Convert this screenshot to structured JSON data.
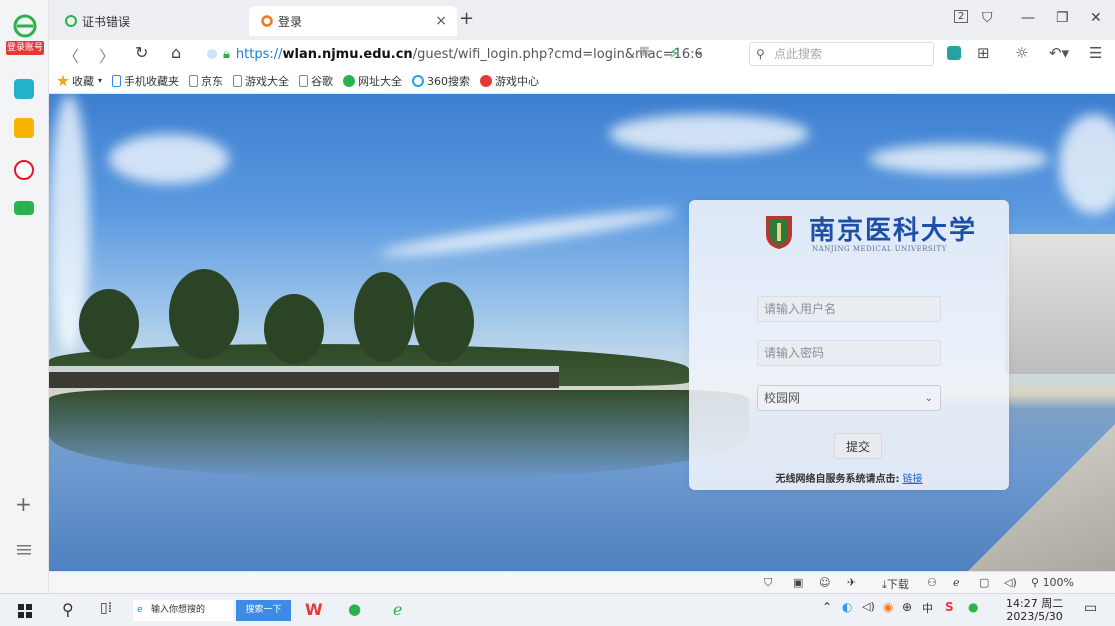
{
  "sidebar": {
    "login_label": "登录账号"
  },
  "tabs": [
    {
      "title": "证书错误"
    },
    {
      "title": "登录"
    }
  ],
  "address": {
    "scheme": "https://",
    "host": "wlan.njmu.edu.cn",
    "path": "/guest/wifi_login.php?cmd=login&mac=16:6",
    "search_placeholder": "点此搜索"
  },
  "bookmarks": [
    {
      "label": "收藏",
      "icon": "star-icon",
      "color": "#f5a623"
    },
    {
      "label": "手机收藏夹",
      "icon": "phone-icon",
      "color": "#2d8cf0"
    },
    {
      "label": "京东",
      "icon": "page-icon",
      "color": "#888888"
    },
    {
      "label": "游戏大全",
      "icon": "page-icon",
      "color": "#888888"
    },
    {
      "label": "谷歌",
      "icon": "page-icon",
      "color": "#888888"
    },
    {
      "label": "网址大全",
      "icon": "globe-icon",
      "color": "#2bb24c"
    },
    {
      "label": "360搜索",
      "icon": "search360-icon",
      "color": "#2aa0e8"
    },
    {
      "label": "游戏中心",
      "icon": "game-icon",
      "color": "#e53935"
    }
  ],
  "login": {
    "university_cn": "南京医科大学",
    "university_en": "NANJING MEDICAL UNIVERSITY",
    "username_placeholder": "请输入用户名",
    "password_placeholder": "请输入密码",
    "network_selected": "校园网",
    "submit_label": "提交",
    "selfservice_text": "无线网络自服务系统请点击:",
    "selfservice_link": "链接"
  },
  "statusbar": {
    "download_label": "下载",
    "zoom": "100%"
  },
  "taskbar": {
    "search_placeholder": "输入你想搜的",
    "search_button": "搜索一下",
    "time": "14:27 周二",
    "date": "2023/5/30"
  },
  "colors": {
    "accent": "#1e4fa6",
    "link": "#1f5fcf",
    "login_badge": "#e53935"
  }
}
